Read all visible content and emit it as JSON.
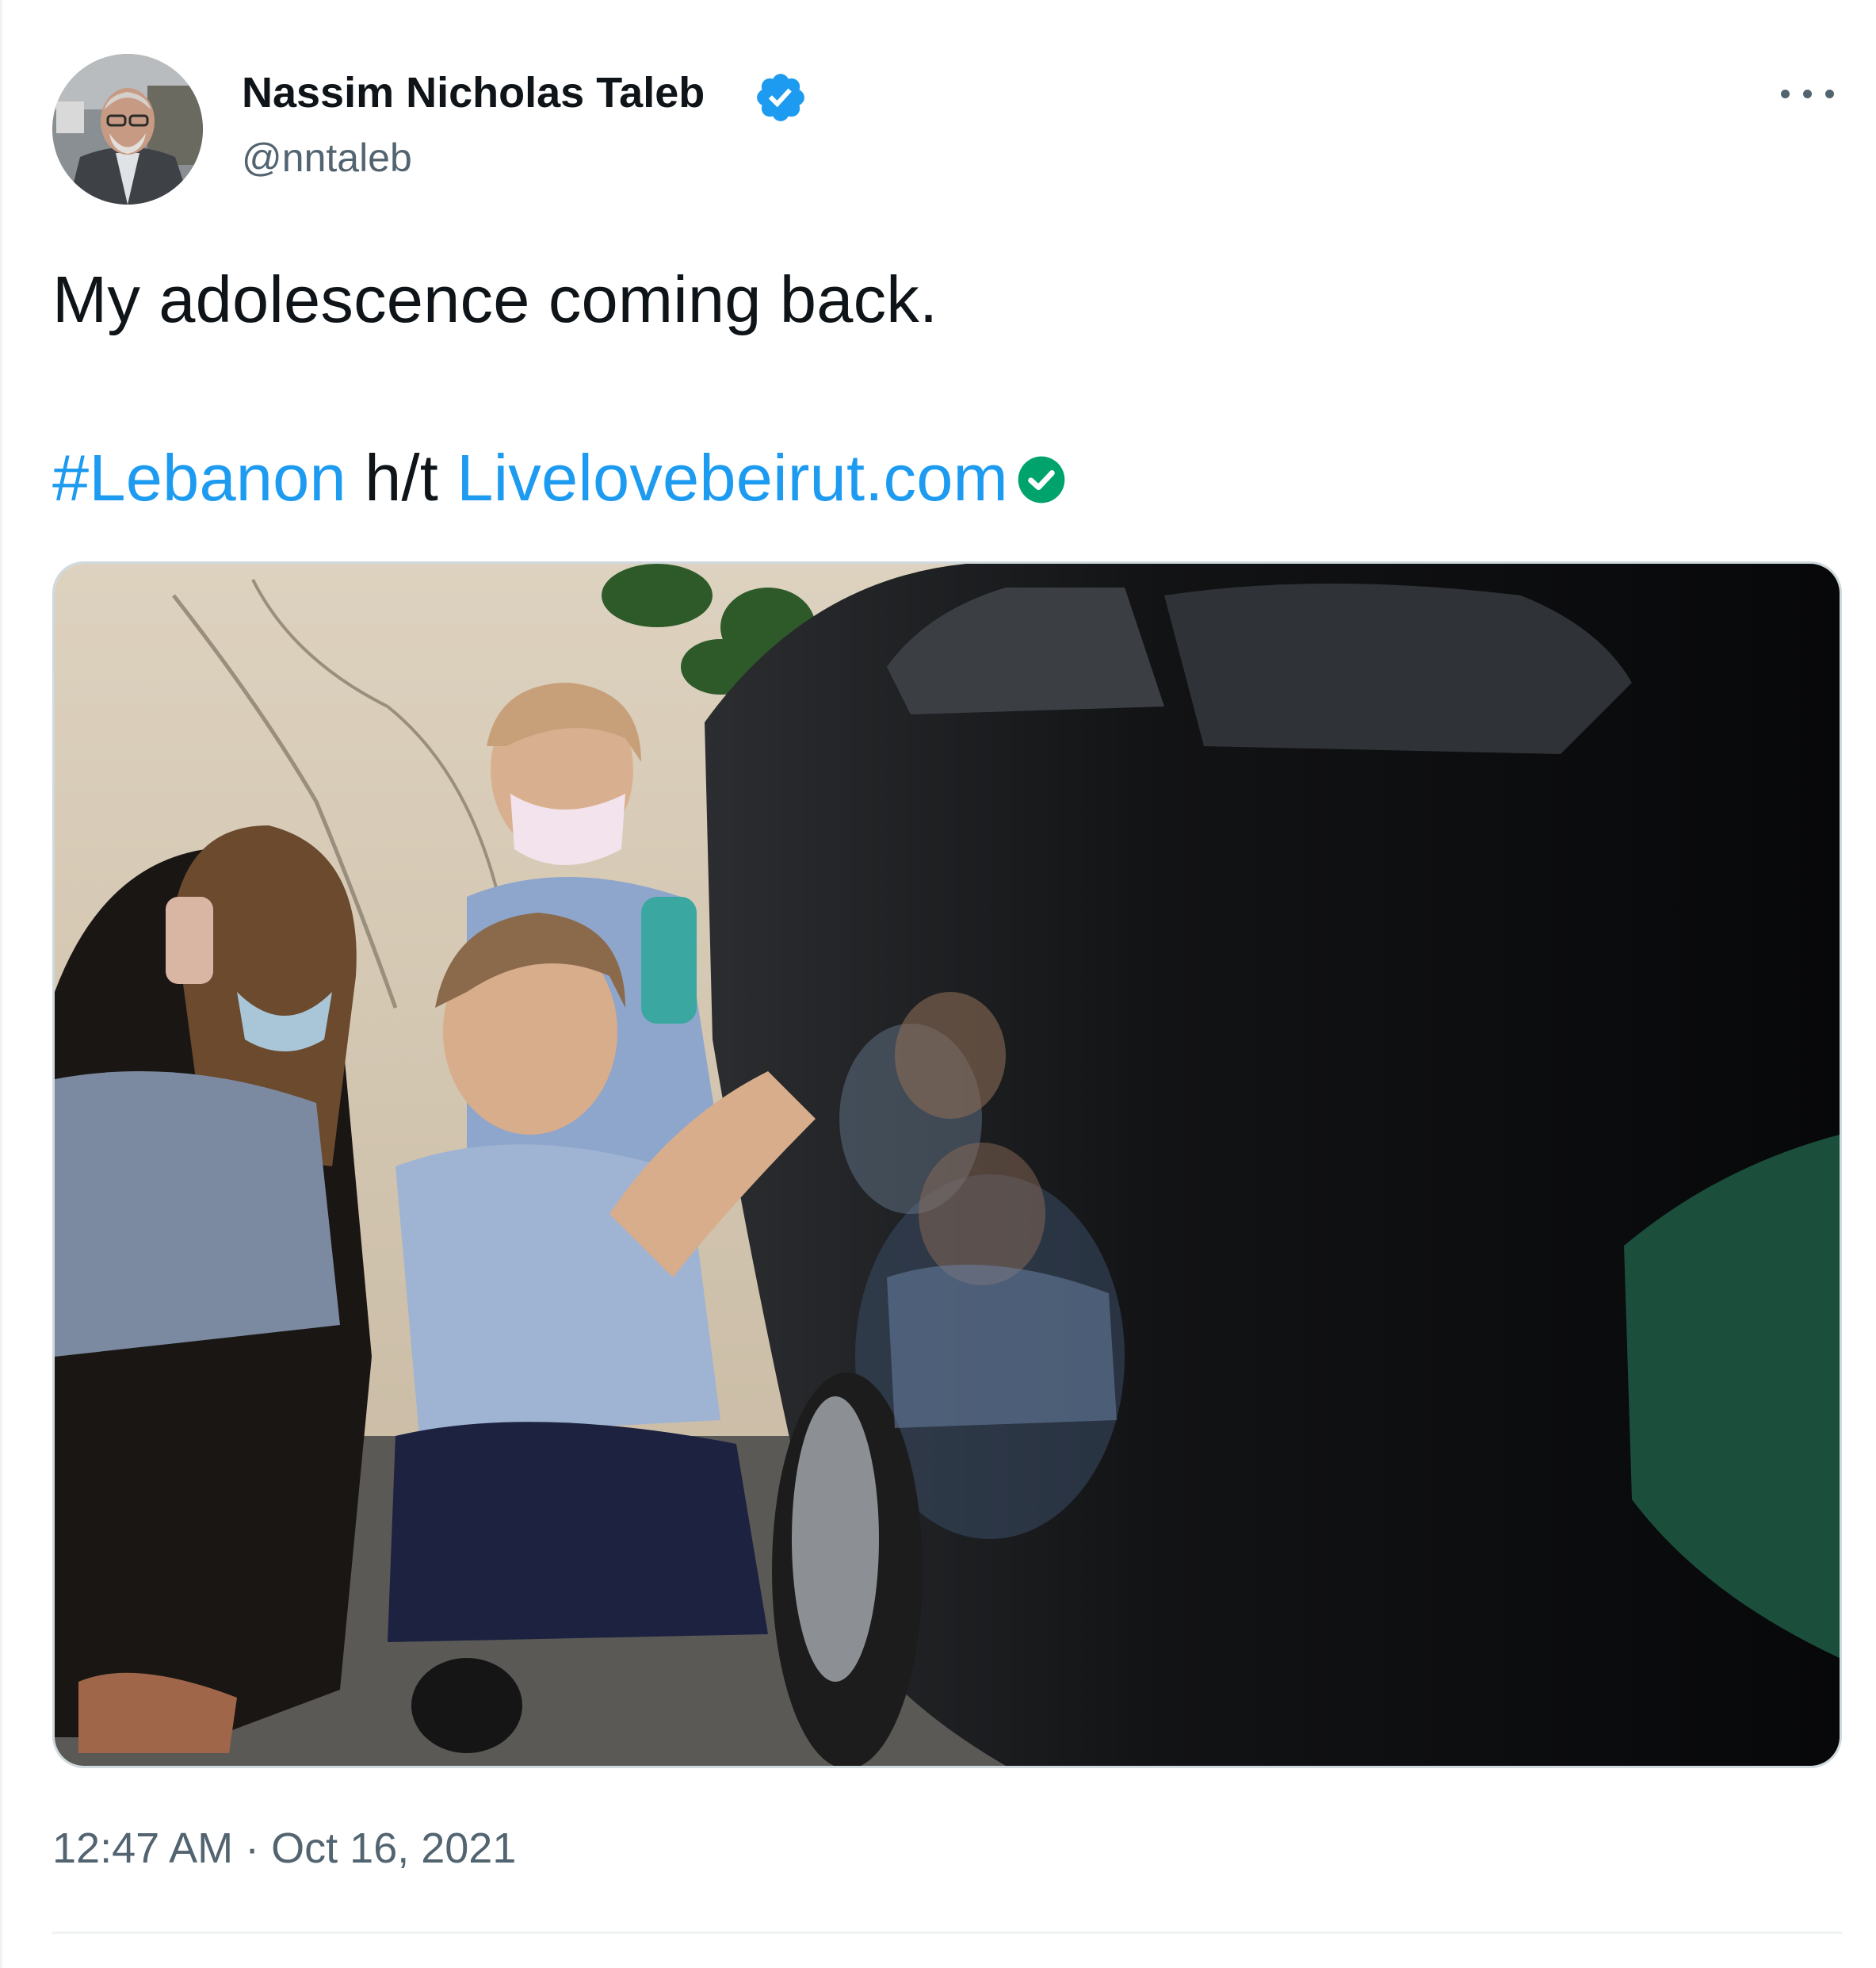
{
  "author": {
    "name": "Nassim Nicholas Taleb",
    "handle": "@nntaleb",
    "verified_badge_color": "#1d9bf0"
  },
  "tweet": {
    "line1": "My adolescence coming back.",
    "hashtag": "#Lebanon",
    "connector": " h/t ",
    "mention": "Livelovebeirut.com",
    "mention_badge_color": "#00a36c",
    "link_color": "#1d9bf0"
  },
  "media": {
    "description_icon": "photo"
  },
  "timestamp": {
    "time": "12:47 AM",
    "separator": " · ",
    "date": "Oct 16, 2021"
  },
  "icons": {
    "more": "more-horizontal-icon",
    "verified": "verified-badge-icon",
    "mention_verified": "verified-check-icon"
  }
}
